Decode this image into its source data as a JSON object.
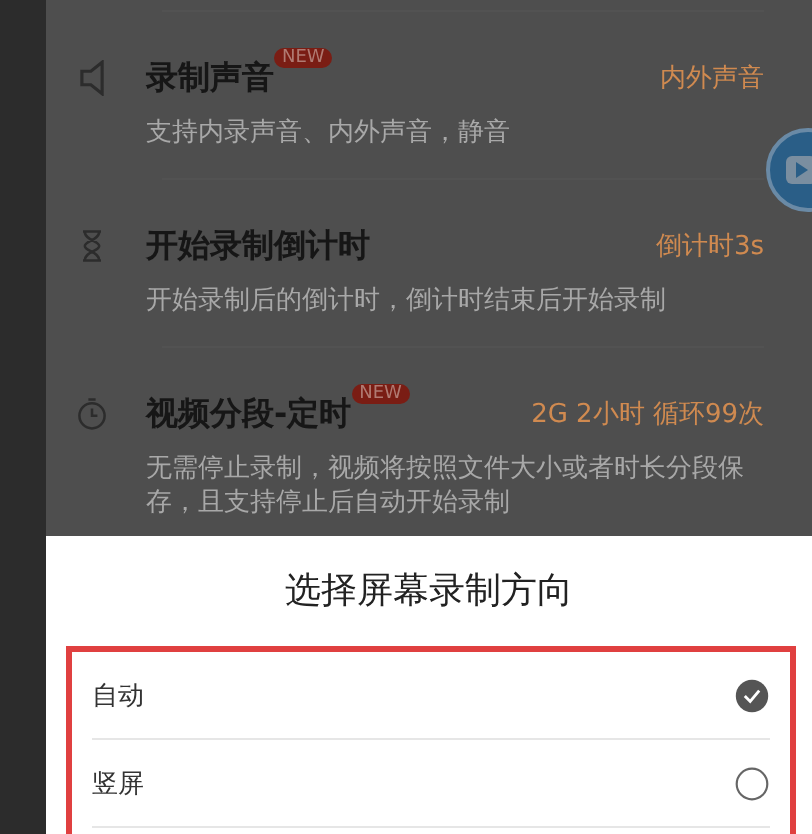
{
  "settings": [
    {
      "title": "录制声音",
      "badge": "NEW",
      "value": "内外声音",
      "description": "支持内录声音、内外声音，静音"
    },
    {
      "title": "开始录制倒计时",
      "value": "倒计时3s",
      "description": "开始录制后的倒计时，倒计时结束后开始录制"
    },
    {
      "title": "视频分段-定时",
      "badge": "NEW",
      "value": "2G 2小时 循环99次",
      "description": "无需停止录制，视频将按照文件大小或者时长分段保存，且支持停止后自动开始录制"
    }
  ],
  "sheet": {
    "title": "选择屏幕录制方向",
    "options": [
      {
        "label": "自动",
        "selected": true
      },
      {
        "label": "竖屏",
        "selected": false
      }
    ]
  }
}
